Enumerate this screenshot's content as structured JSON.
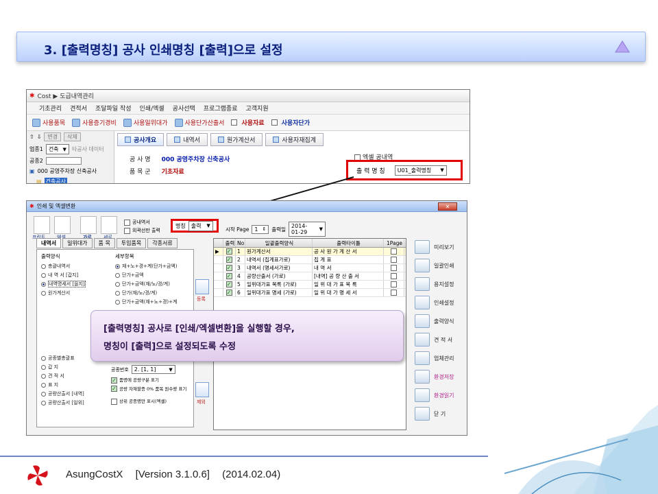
{
  "header": {
    "title": "3. [출력명칭] 공사 인쇄명칭 [출력]으로 설정"
  },
  "shot1": {
    "window_title": "Cost ▶ 도급내역관리",
    "menu": [
      "기초관리",
      "견적서",
      "조달파일 작성",
      "인쇄/엑셀",
      "공사선택",
      "프로그램종료",
      "고객지원"
    ],
    "toolbar": {
      "t1": "사용품목",
      "t2": "사용증기경비",
      "t3": "사용일위대가",
      "t4": "사용단가산출서",
      "t5": "사용자료",
      "t6": "사용자단가"
    },
    "tree": {
      "btn_change": "변경",
      "btn_delete": "삭제",
      "type_label": "업종1",
      "type_value": "건축",
      "item_btn": "타공사 데이터",
      "group_label": "공종2",
      "project": "000 공영주차장 신축공사",
      "selected": "건축공사"
    },
    "tabs": [
      "공사개요",
      "내역서",
      "원가계산서",
      "사용자재집계"
    ],
    "fields": {
      "project_name_label": "공 사 명",
      "project_name_value": "000 공영주차장 신축공사",
      "item_group_label": "품 목 군",
      "item_group_value": "기초자료"
    },
    "excel_label": "엑셀 공내역",
    "output_name_label": "출 력 명 칭",
    "output_name_value": "U01_출력명칭"
  },
  "shot2": {
    "window_title": "인쇄 및 엑셀변환",
    "top_tools": {
      "print": "프린트",
      "excel": "엑셀",
      "landscape": "가로",
      "portrait": "세로"
    },
    "checks": {
      "a": "공내역서",
      "b": "외곽선만 출력"
    },
    "name_label": "명칭",
    "name_value": "출력",
    "start_label": "시작 Page",
    "start_value": "1",
    "date_label": "출력일",
    "date_value": "2014-01-29",
    "inner_tabs": [
      "내역서",
      "일위대가",
      "품 목",
      "투입품목",
      "각종서류"
    ],
    "output_style_label": "출력양식",
    "output_styles": [
      "총괄내역서",
      "내 역 서 [갑지]",
      "내역명세서 [을지]",
      "원가계산서"
    ],
    "detail_label": "세부항목",
    "details": [
      "재+노+경+계(단가+금액)",
      "단가+금액",
      "단가+금액(재/노/경/계)",
      "단가(재/노/경/계)",
      "단가+금액(재+노+경)+계"
    ],
    "lower_options": [
      "공종별총괄표",
      "갑 지",
      "견 적 서",
      "표 지",
      "공량산출서 [내역]",
      "공량산출서 [일위]"
    ],
    "section_no_label": "공종번호",
    "section_no_value": "2. [1, 1]",
    "lower_checks": [
      "품명에 공량구분 표기",
      "공량 자재할증 0% 품목 원수량 표기",
      "상위 공종명만 표시(엑셀)"
    ],
    "mid_buttons": {
      "add": "등록",
      "remove": "제외"
    },
    "grid": {
      "headers": [
        "출력",
        "No",
        "일괄출력양식",
        "출력타이틀",
        "1Page"
      ],
      "rows": [
        [
          "1",
          "원가계산서",
          "공 사 원 가 계 산 서"
        ],
        [
          "2",
          "내역서 (집계표가로)",
          "집 계 표"
        ],
        [
          "3",
          "내역서 (명세서가로)",
          "내 역 서"
        ],
        [
          "4",
          "공량산출서 (가로)",
          "[내역] 공 량 산 출 서"
        ],
        [
          "5",
          "일위대가표 목록 (가로)",
          "일 위 대 가 표 목 록"
        ],
        [
          "6",
          "일위대가표 명세 (가로)",
          "일 위 대 가 명 세 서"
        ]
      ]
    },
    "side_buttons": [
      "미리보기",
      "일괄인쇄",
      "용지설정",
      "인쇄설정",
      "출력양식",
      "견 적 서",
      "업체관리",
      "환경저장",
      "환경읽기",
      "닫 기"
    ]
  },
  "callout": {
    "line1": "[출력명칭] 공사로 [인쇄/엑셀변환]을 실행할 경우,",
    "line2": "명칭이 [출력]으로 설정되도록 수정"
  },
  "footer": {
    "product": "AsungCostX",
    "version": "[Version 3.1.0.6]",
    "date": "(2014.02.04)"
  },
  "colors": {
    "title_text": "#0b1f7d",
    "highlight_red": "#e00000",
    "callout_text": "#2b0f4a"
  }
}
